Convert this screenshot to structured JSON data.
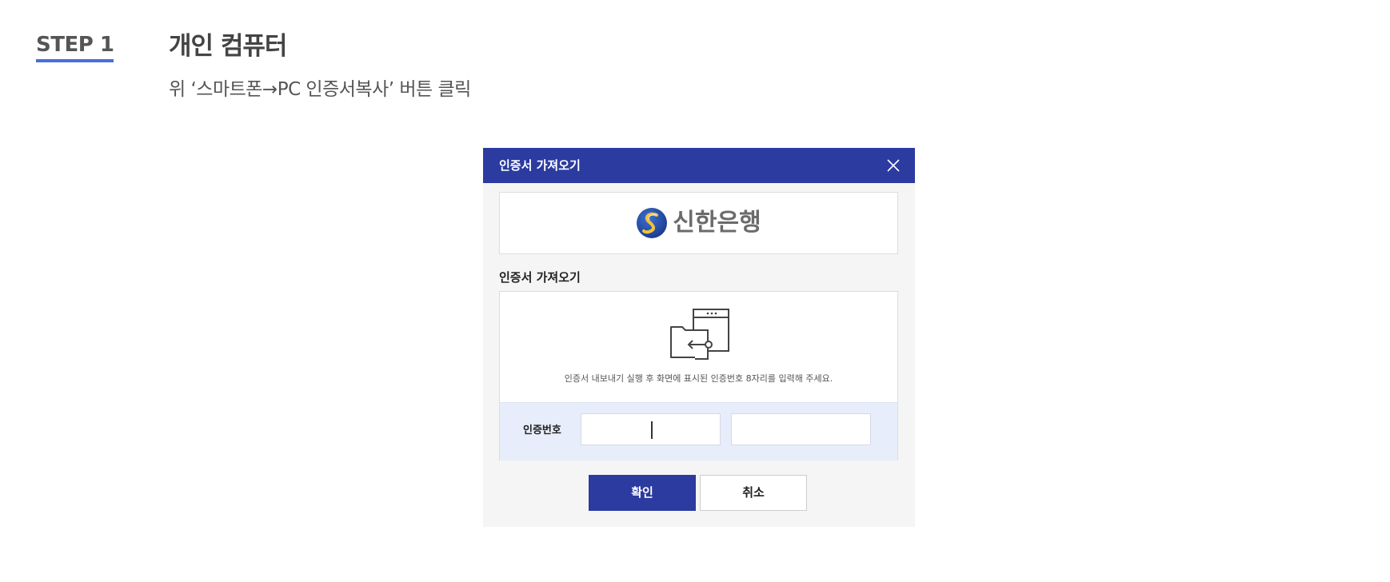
{
  "step": {
    "label": "STEP 1",
    "title": "개인 컴퓨터",
    "description": "위 ‘스마트폰→PC 인증서복사’ 버튼 클릭"
  },
  "dialog": {
    "title": "인증서 가져오기",
    "close_icon": "close-icon",
    "bank_logo_text": "신한은행",
    "bank_logo_icon": "shinhan-emblem-icon",
    "section_title": "인증서 가져오기",
    "import_icon": "certificate-import-icon",
    "instruction": "인증서 내보내기 실행 후 화면에 표시된 인증번호 8자리를 입력해 주세요.",
    "code_label": "인증번호",
    "code_input_1_value": "",
    "code_input_2_value": "",
    "confirm_label": "확인",
    "cancel_label": "취소"
  },
  "colors": {
    "accent": "#2b3ba0",
    "step_underline": "#4a6fd8",
    "code_row_bg": "#e8edfb"
  }
}
